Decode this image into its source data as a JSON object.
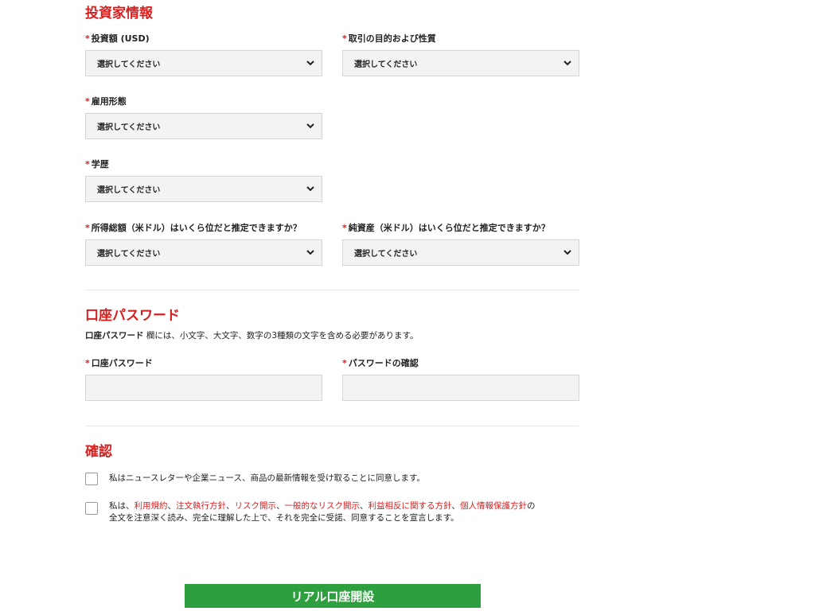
{
  "investor": {
    "title": "投資家情報",
    "required_mark": "*",
    "amount_label": "投資額 (USD)",
    "purpose_label": "取引の目的および性質",
    "employment_label": "雇用形態",
    "education_label": "学歴",
    "income_label": "所得総額（米ドル）はいくら位だと推定できますか？",
    "networth_label": "純資産（米ドル）はいくら位だと推定できますか？",
    "select_placeholder": "選択してください"
  },
  "password": {
    "title": "口座パスワード",
    "note_bold": "口座パスワード",
    "note_rest": " 欄には、小文字、大文字、数字の3種類の文字を含める必要があります。",
    "password_label": "口座パスワード",
    "confirm_label": "パスワードの確認"
  },
  "confirm": {
    "title": "確認",
    "newsletter_text": "私はニュースレターや企業ニュース、商品の最新情報を受け取ることに同意します。",
    "terms_prefix": "私は、",
    "link_terms": "利用規約",
    "link_execution": "注文執行方針",
    "link_risk": "リスク開示",
    "link_general_risk": "一般的なリスク開示",
    "link_conflict": "利益相反に関する方針",
    "link_privacy": "個人情報保護方針",
    "sep": "、",
    "terms_suffix_1": "の",
    "terms_suffix_2": "全文を注意深く読み、完全に理解した上で、それを完全に受諾、同意することを宣言します。"
  },
  "submit_label": "リアル口座開設",
  "colors": {
    "accent_red": "#d62020",
    "submit_green": "#2e9f3e",
    "field_bg": "#f3f3f3"
  },
  "icons": {
    "select_arrow": "chevron-down-icon"
  }
}
